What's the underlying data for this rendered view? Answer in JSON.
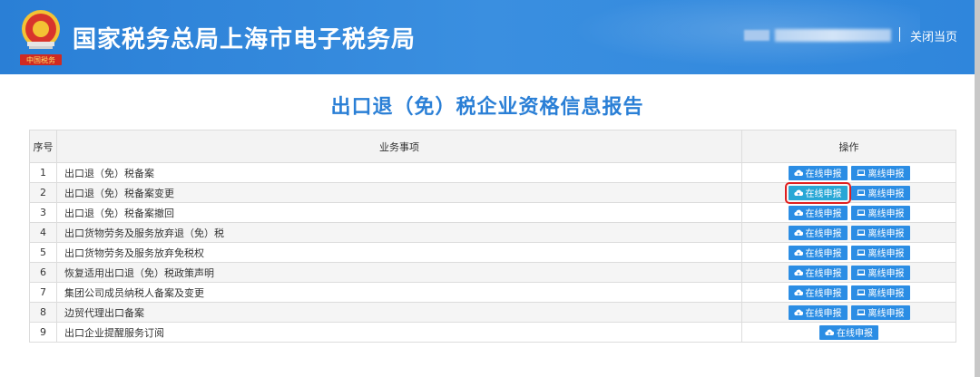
{
  "header": {
    "site_title": "国家税务总局上海市电子税务局",
    "seal_text": "中国税务",
    "close_label": "关闭当页"
  },
  "page_title": "出口退（免）税企业资格信息报告",
  "table": {
    "columns": [
      "序号",
      "业务事项",
      "操作"
    ],
    "online_label": "在线申报",
    "offline_label": "离线申报",
    "rows": [
      {
        "no": "1",
        "item": "出口退（免）税备案",
        "has_offline": true
      },
      {
        "no": "2",
        "item": "出口退（免）税备案变更",
        "has_offline": true,
        "highlight": true
      },
      {
        "no": "3",
        "item": "出口退（免）税备案撤回",
        "has_offline": true
      },
      {
        "no": "4",
        "item": "出口货物劳务及服务放弃退（免）税",
        "has_offline": true
      },
      {
        "no": "5",
        "item": "出口货物劳务及服务放弃免税权",
        "has_offline": true
      },
      {
        "no": "6",
        "item": "恢复适用出口退（免）税政策声明",
        "has_offline": true
      },
      {
        "no": "7",
        "item": "集团公司成员纳税人备案及变更",
        "has_offline": true
      },
      {
        "no": "8",
        "item": "边贸代理出口备案",
        "has_offline": true
      },
      {
        "no": "9",
        "item": "出口企业提醒服务订阅",
        "has_offline": false
      }
    ]
  },
  "icons": {
    "online": "cloud-upload-icon",
    "offline": "laptop-icon",
    "emblem": "tax-emblem-icon"
  },
  "colors": {
    "header": "#2f86dc",
    "title": "#2a7fd6",
    "button": "#2b8de4",
    "highlight_border": "#e02020"
  }
}
